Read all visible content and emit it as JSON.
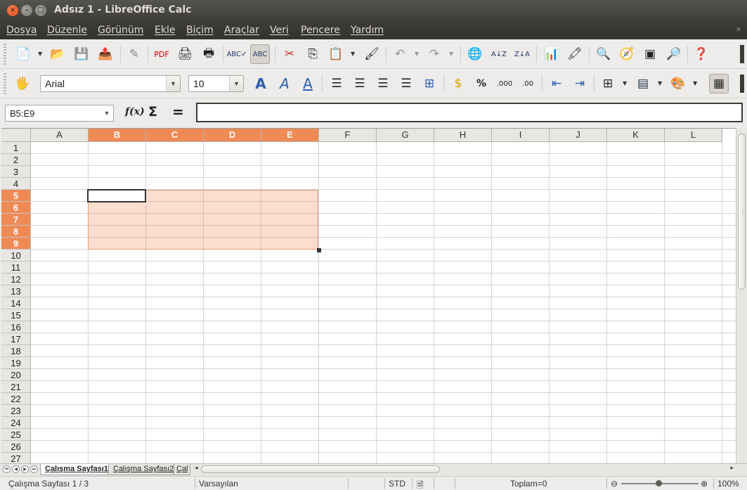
{
  "window": {
    "title": "Adsız 1 - LibreOffice Calc"
  },
  "menu": [
    "Dosya",
    "Düzenle",
    "Görünüm",
    "Ekle",
    "Biçim",
    "Araçlar",
    "Veri",
    "Pencere",
    "Yardım"
  ],
  "formatting": {
    "font_name": "Arial",
    "font_size": "10"
  },
  "formula_bar": {
    "name_box": "B5:E9",
    "input": ""
  },
  "icons_labels": {
    "fx": "f(x)",
    "sum": "Σ",
    "equals": "="
  },
  "columns": [
    "A",
    "B",
    "C",
    "D",
    "E",
    "F",
    "G",
    "H",
    "I",
    "J",
    "K",
    "L"
  ],
  "selected_columns": [
    "B",
    "C",
    "D",
    "E"
  ],
  "rows": [
    "1",
    "2",
    "3",
    "4",
    "5",
    "6",
    "7",
    "8",
    "9",
    "10",
    "11",
    "12",
    "13",
    "14",
    "15",
    "16",
    "17",
    "18",
    "19",
    "20",
    "21",
    "22",
    "23",
    "24",
    "25",
    "26",
    "27"
  ],
  "selected_rows": [
    "5",
    "6",
    "7",
    "8",
    "9"
  ],
  "sheets": [
    {
      "label": "Çalışma Sayfası1",
      "active": true
    },
    {
      "label": "Çalışma Sayfası2",
      "active": false
    },
    {
      "label": "Çal",
      "active": false
    }
  ],
  "status": {
    "sheet_info": "Çalışma Sayfası 1 / 3",
    "page_style": "Varsayılan",
    "selection_mode": "STD",
    "sum": "Toplam=0",
    "zoom": "100%"
  },
  "colors": {
    "selection_header": "#f08a55",
    "selection_fill": "#fbd8c7",
    "titlebar": "#3c3b37"
  }
}
